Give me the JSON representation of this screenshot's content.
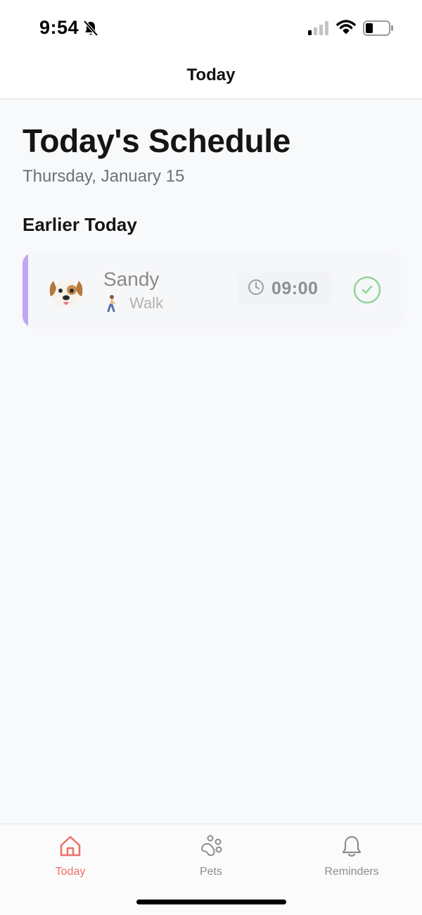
{
  "status_bar": {
    "time": "9:54"
  },
  "nav": {
    "title": "Today"
  },
  "page": {
    "title": "Today's Schedule",
    "date": "Thursday, January 15",
    "section": "Earlier Today"
  },
  "schedule": [
    {
      "pet_name": "Sandy",
      "activity": "Walk",
      "time": "09:00",
      "completed": true
    }
  ],
  "tabs": [
    {
      "label": "Today",
      "icon": "home-icon",
      "active": true
    },
    {
      "label": "Pets",
      "icon": "paw-icon",
      "active": false
    },
    {
      "label": "Reminders",
      "icon": "bell-icon",
      "active": false
    }
  ],
  "colors": {
    "accent": "#ef6f6c",
    "card_stripe": "#bfa6f5",
    "done": "#8fd49a"
  }
}
